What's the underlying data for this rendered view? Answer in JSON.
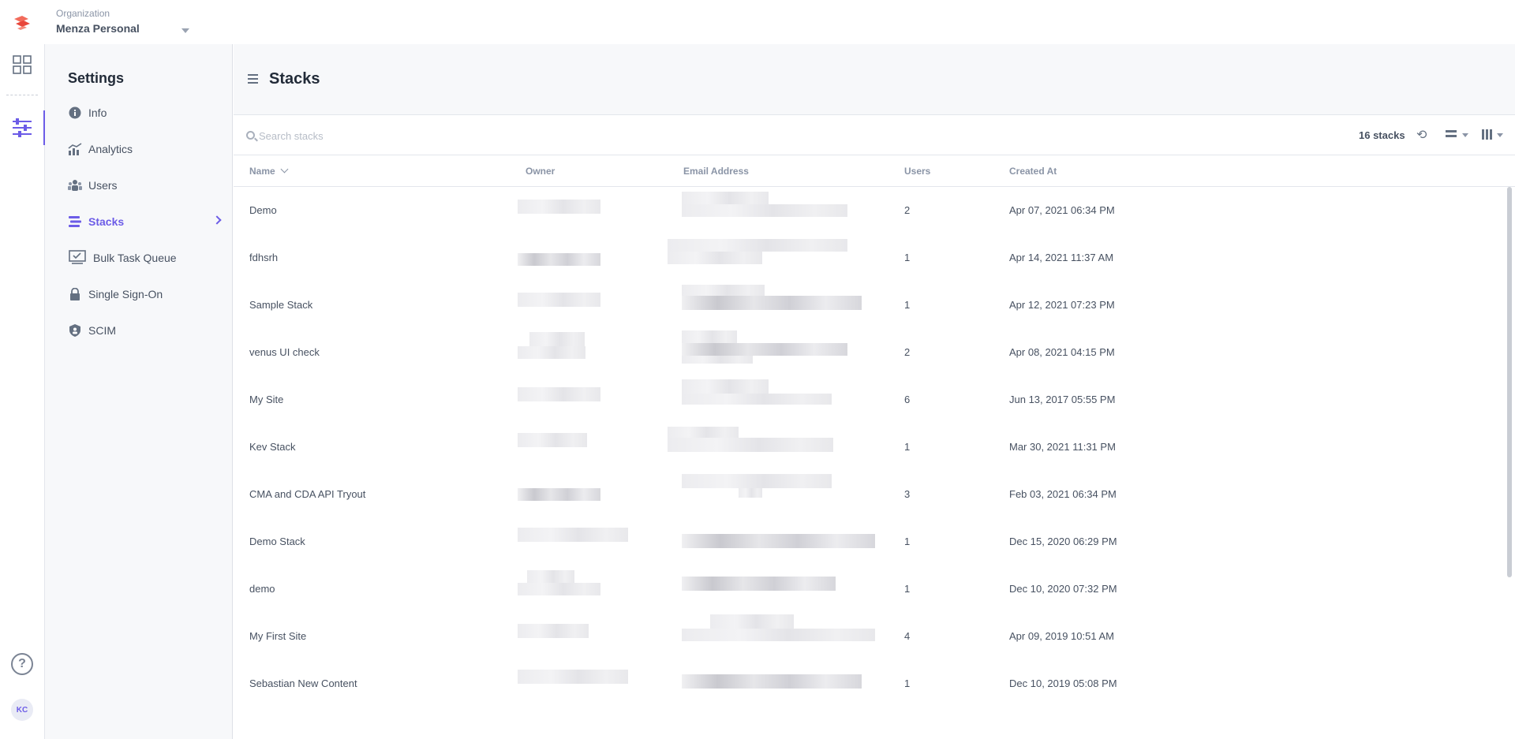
{
  "organization": {
    "label": "Organization",
    "name": "Menza Personal"
  },
  "rail": {
    "avatar_initials": "KC",
    "help_glyph": "?"
  },
  "sidebar": {
    "title": "Settings",
    "items": [
      {
        "label": "Info",
        "icon": "info-icon"
      },
      {
        "label": "Analytics",
        "icon": "analytics-icon"
      },
      {
        "label": "Users",
        "icon": "users-icon"
      },
      {
        "label": "Stacks",
        "icon": "stacks-icon",
        "active": true
      },
      {
        "label": "Bulk Task Queue",
        "icon": "bulk-task-icon"
      },
      {
        "label": "Single Sign-On",
        "icon": "lock-icon"
      },
      {
        "label": "SCIM",
        "icon": "shield-icon"
      }
    ]
  },
  "main": {
    "title": "Stacks",
    "search": {
      "placeholder": "Search stacks",
      "value": ""
    },
    "count_label": "16 stacks",
    "columns": {
      "name": "Name",
      "owner": "Owner",
      "email": "Email Address",
      "users": "Users",
      "created": "Created At"
    },
    "rows": [
      {
        "name": "Demo",
        "users": "2",
        "created": "Apr 07, 2021 06:34 PM"
      },
      {
        "name": "fdhsrh",
        "users": "1",
        "created": "Apr 14, 2021 11:37 AM"
      },
      {
        "name": "Sample Stack",
        "users": "1",
        "created": "Apr 12, 2021 07:23 PM"
      },
      {
        "name": "venus UI check",
        "users": "2",
        "created": "Apr 08, 2021 04:15 PM"
      },
      {
        "name": "My Site",
        "users": "6",
        "created": "Jun 13, 2017 05:55 PM"
      },
      {
        "name": "Kev Stack",
        "users": "1",
        "created": "Mar 30, 2021 11:31 PM"
      },
      {
        "name": "CMA and CDA API Tryout",
        "users": "3",
        "created": "Feb 03, 2021 06:34 PM"
      },
      {
        "name": "Demo Stack",
        "users": "1",
        "created": "Dec 15, 2020 06:29 PM"
      },
      {
        "name": "demo",
        "users": "1",
        "created": "Dec 10, 2020 07:32 PM"
      },
      {
        "name": "My First Site",
        "users": "4",
        "created": "Apr 09, 2019 10:51 AM"
      },
      {
        "name": "Sebastian New Content",
        "users": "1",
        "created": "Dec 10, 2019 05:08 PM"
      }
    ]
  },
  "colors": {
    "accent": "#6c5ce7",
    "brand": "#f05a4a"
  }
}
